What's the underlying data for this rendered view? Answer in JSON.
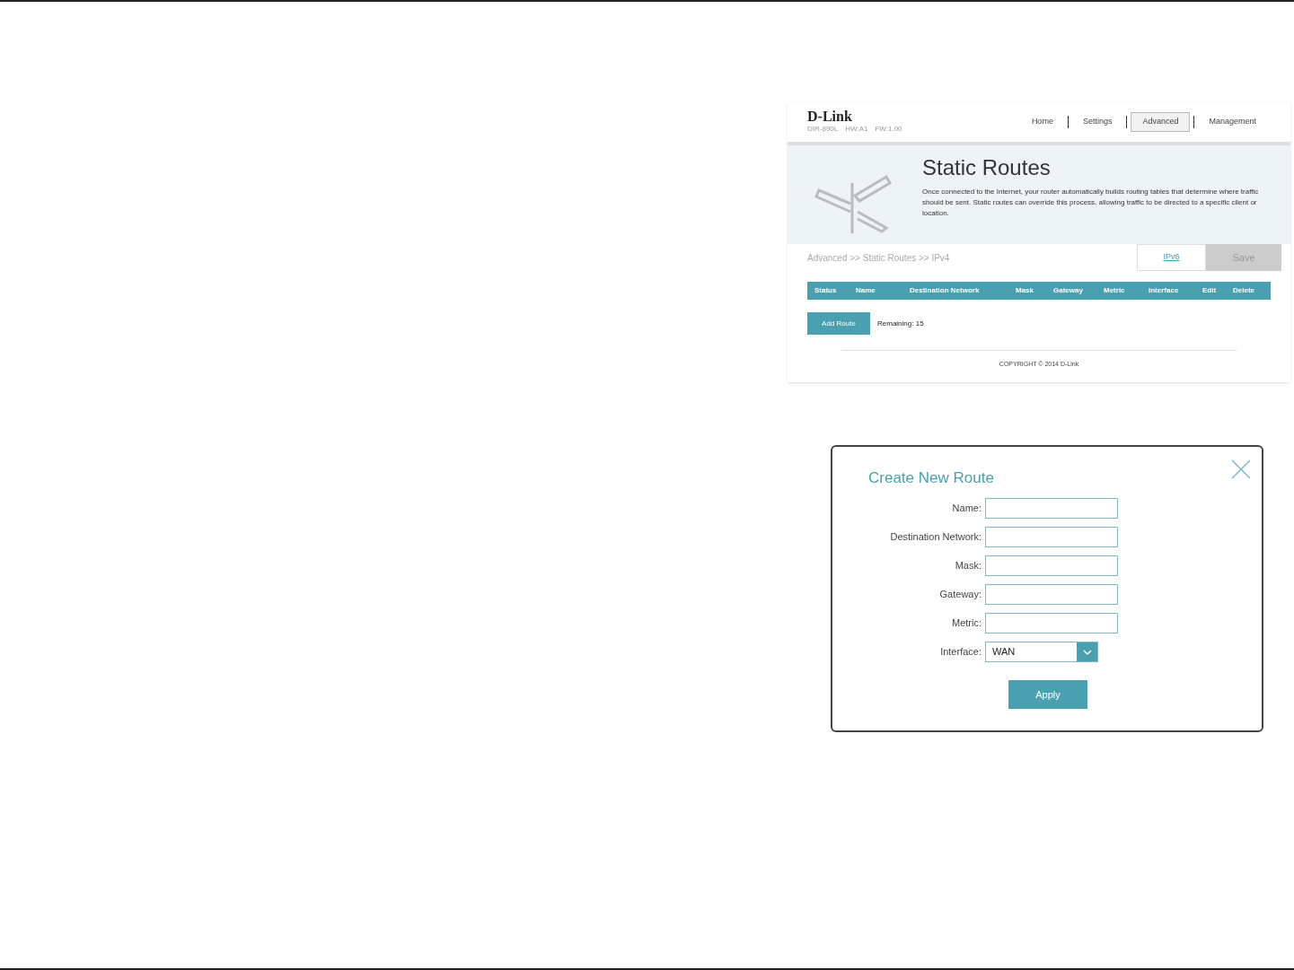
{
  "router_page": {
    "logo": "D-Link",
    "device_info": [
      "DIR-890L",
      "HW:A1",
      "FW:1.00"
    ],
    "nav": [
      {
        "label": "Home",
        "selected": false
      },
      {
        "label": "Settings",
        "selected": false
      },
      {
        "label": "Advanced",
        "selected": true
      },
      {
        "label": "Management",
        "selected": false
      }
    ],
    "title": "Static Routes",
    "description": "Once connected to the Internet, your router automatically builds routing tables that determine where traffic should be sent. Static routes can override this process, allowing traffic to be directed to a specific client or location.",
    "breadcrumb": "Advanced >> Static Routes >> IPv4",
    "ipv6_link": "IPv6",
    "save_button": {
      "label": "Save",
      "disabled": true
    },
    "table": {
      "columns": [
        "Status",
        "Name",
        "Destination Network",
        "Mask",
        "Gateway",
        "Metric",
        "Interface",
        "Edit",
        "Delete"
      ]
    },
    "add_button": "Add Route",
    "remaining": "Remaining: 15",
    "footer": "COPYRIGHT © 2014 D-Link"
  },
  "dialog": {
    "title": "Create New Route",
    "fields": [
      {
        "label": "Name:",
        "kind": "text"
      },
      {
        "label": "Destination Network:",
        "kind": "text"
      },
      {
        "label": "Mask:",
        "kind": "text"
      },
      {
        "label": "Gateway:",
        "kind": "text"
      },
      {
        "label": "Metric:",
        "kind": "text"
      },
      {
        "label": "Interface:",
        "kind": "select",
        "value": "WAN"
      }
    ],
    "apply_button": "Apply"
  }
}
